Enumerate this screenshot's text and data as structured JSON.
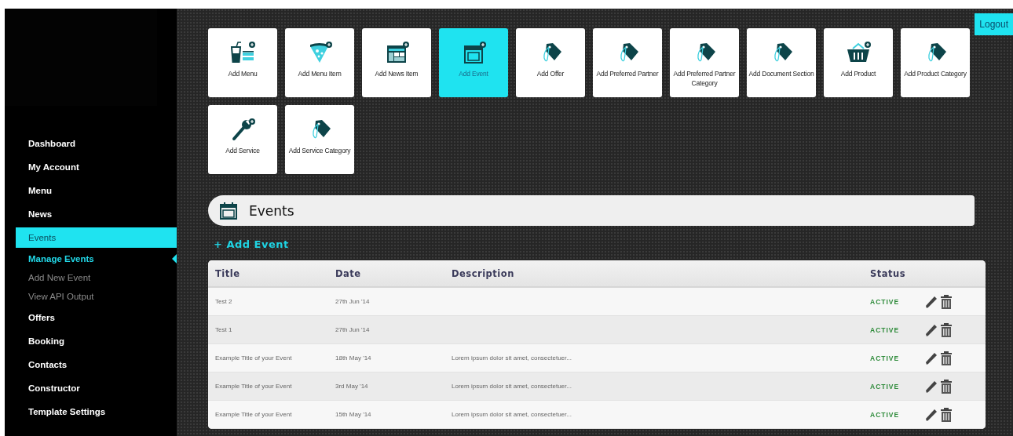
{
  "sidebar": {
    "items": [
      {
        "label": "Dashboard",
        "selected": false
      },
      {
        "label": "My Account",
        "selected": false
      },
      {
        "label": "Menu",
        "selected": false
      },
      {
        "label": "News",
        "selected": false
      },
      {
        "label": "Events",
        "selected": true,
        "children": [
          {
            "label": "Manage Events",
            "selected": true
          },
          {
            "label": "Add New Event",
            "selected": false
          },
          {
            "label": "View API Output",
            "selected": false
          }
        ]
      },
      {
        "label": "Offers",
        "selected": false
      },
      {
        "label": "Booking",
        "selected": false
      },
      {
        "label": "Contacts",
        "selected": false
      },
      {
        "label": "Constructor",
        "selected": false
      },
      {
        "label": "Template Settings",
        "selected": false
      }
    ]
  },
  "logout": "Logout",
  "tiles": [
    {
      "label": "Add Menu",
      "kind": "menu",
      "selected": false
    },
    {
      "label": "Add Menu Item",
      "kind": "pizza",
      "selected": false
    },
    {
      "label": "Add News Item",
      "kind": "news",
      "selected": false
    },
    {
      "label": "Add Event",
      "kind": "calendar",
      "selected": true
    },
    {
      "label": "Add Offer",
      "kind": "tag",
      "selected": false
    },
    {
      "label": "Add Preferred Partner",
      "kind": "tag",
      "selected": false
    },
    {
      "label": "Add Preferred Partner Category",
      "kind": "tag",
      "selected": false
    },
    {
      "label": "Add Document Section",
      "kind": "tag",
      "selected": false
    },
    {
      "label": "Add Product",
      "kind": "basket",
      "selected": false
    },
    {
      "label": "Add Product Category",
      "kind": "tag",
      "selected": false
    },
    {
      "label": "Add Service",
      "kind": "wrench",
      "selected": false
    },
    {
      "label": "Add Service Category",
      "kind": "tag",
      "selected": false
    }
  ],
  "section": {
    "title": "Events",
    "add_link": "+ Add Event"
  },
  "table": {
    "columns": [
      "Title",
      "Date",
      "Description",
      "Status"
    ],
    "rows": [
      {
        "title": "Test 2",
        "date": "27th Jun '14",
        "description": "",
        "status": "ACTIVE"
      },
      {
        "title": "Test 1",
        "date": "27th Jun '14",
        "description": "",
        "status": "ACTIVE"
      },
      {
        "title": "Example Title of your Event",
        "date": "18th May '14",
        "description": "Lorem ipsum dolor sit amet, consectetuer...",
        "status": "ACTIVE"
      },
      {
        "title": "Example Title of your Event",
        "date": "3rd May '14",
        "description": "Lorem ipsum dolor sit amet, consectetuer...",
        "status": "ACTIVE"
      },
      {
        "title": "Example Title of your Event",
        "date": "15th May '14",
        "description": "Lorem ipsum dolor sit amet, consectetuer...",
        "status": "ACTIVE"
      }
    ]
  }
}
